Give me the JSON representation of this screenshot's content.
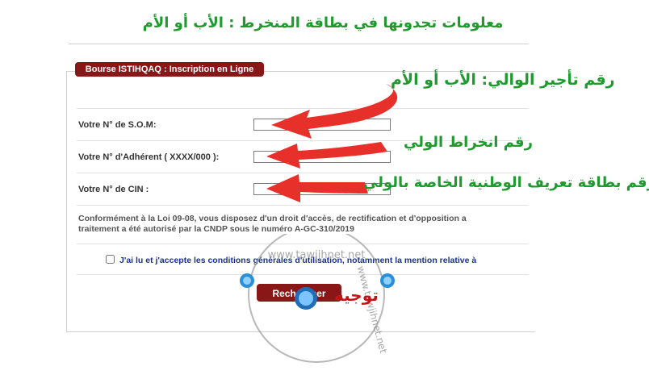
{
  "header": {
    "title": "معلومات تجدونها في بطاقة المنخرط : الأب أو الأم"
  },
  "panel": {
    "tab_label": "Bourse ISTIHQAQ : Inscription en Ligne"
  },
  "form": {
    "som_label": "Votre N° de S.O.M:",
    "som_value": "",
    "adherent_label": "Votre N° d'Adhérent ( XXXX/000 ):",
    "adherent_value": "",
    "cin_label": "Votre N° de CIN :",
    "cin_value": ""
  },
  "legal": {
    "line1": "Conformément à la Loi 09-08, vous disposez d'un droit d'accès, de rectification et d'opposition a",
    "line2": "traitement a été autorisé par la CNDP sous le numéro A-GC-310/2019"
  },
  "consent": {
    "text": "J'ai lu et j'accepte les conditions générales d'utilisation, notamment la mention relative à",
    "checked": false
  },
  "search_button": {
    "label": "Rechercher"
  },
  "annotations": {
    "som": "رقم تأجير الوالي: الأب أو الأم",
    "adherent": "رقم انخراط الولي",
    "cin": "رقم بطاقة تعريف الوطنية الخاصة بالولي",
    "color": "#1e9a2e",
    "arrow_color": "#e8302a"
  },
  "watermark": {
    "site": "www.tawjihnet.net",
    "label": "توجيه"
  },
  "colors": {
    "accent": "#8a1717",
    "consent_text": "#1b2f9c",
    "title": "#1e9a2e"
  }
}
